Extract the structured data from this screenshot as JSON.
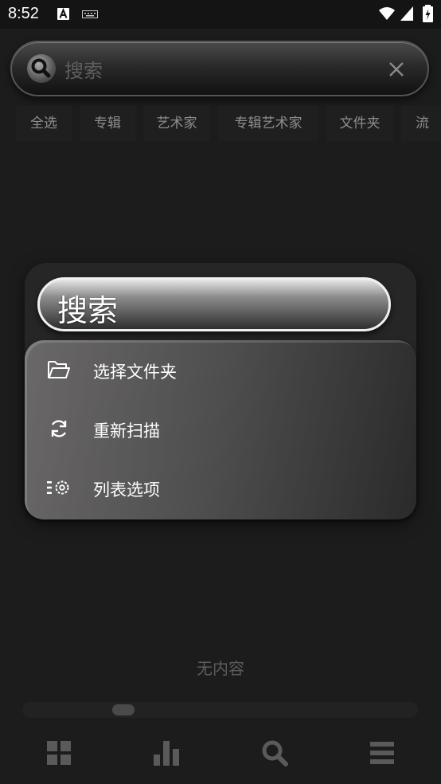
{
  "status_bar": {
    "time": "8:52"
  },
  "search": {
    "placeholder": "搜索"
  },
  "filters": [
    "全选",
    "专辑",
    "艺术家",
    "专辑艺术家",
    "文件夹",
    "流"
  ],
  "menu": {
    "title": "搜索",
    "items": [
      {
        "label": "选择文件夹",
        "icon": "folder-open-icon"
      },
      {
        "label": "重新扫描",
        "icon": "refresh-icon"
      },
      {
        "label": "列表选项",
        "icon": "list-settings-icon"
      }
    ]
  },
  "content": {
    "empty_text": "无内容"
  },
  "bottom_nav": [
    {
      "icon": "grid-icon"
    },
    {
      "icon": "bar-chart-icon"
    },
    {
      "icon": "search-icon"
    },
    {
      "icon": "menu-icon"
    }
  ],
  "colors": {
    "background": "#1c1c1c",
    "menu_card": "#262626",
    "accent_text": "#ffffff"
  }
}
